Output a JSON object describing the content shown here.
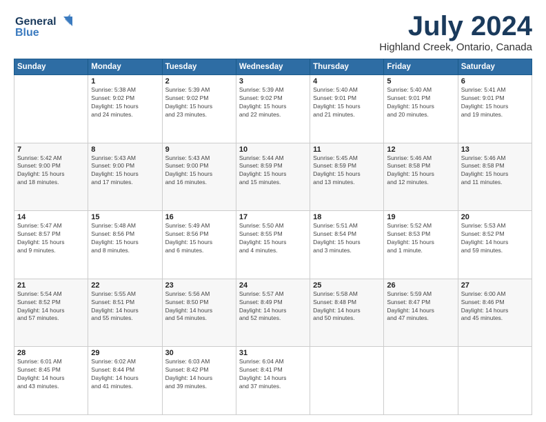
{
  "logo": {
    "line1": "General",
    "line2": "Blue",
    "bird": "▲"
  },
  "title": "July 2024",
  "location": "Highland Creek, Ontario, Canada",
  "days_of_week": [
    "Sunday",
    "Monday",
    "Tuesday",
    "Wednesday",
    "Thursday",
    "Friday",
    "Saturday"
  ],
  "weeks": [
    [
      {
        "day": "",
        "info": ""
      },
      {
        "day": "1",
        "info": "Sunrise: 5:38 AM\nSunset: 9:02 PM\nDaylight: 15 hours\nand 24 minutes."
      },
      {
        "day": "2",
        "info": "Sunrise: 5:39 AM\nSunset: 9:02 PM\nDaylight: 15 hours\nand 23 minutes."
      },
      {
        "day": "3",
        "info": "Sunrise: 5:39 AM\nSunset: 9:02 PM\nDaylight: 15 hours\nand 22 minutes."
      },
      {
        "day": "4",
        "info": "Sunrise: 5:40 AM\nSunset: 9:01 PM\nDaylight: 15 hours\nand 21 minutes."
      },
      {
        "day": "5",
        "info": "Sunrise: 5:40 AM\nSunset: 9:01 PM\nDaylight: 15 hours\nand 20 minutes."
      },
      {
        "day": "6",
        "info": "Sunrise: 5:41 AM\nSunset: 9:01 PM\nDaylight: 15 hours\nand 19 minutes."
      }
    ],
    [
      {
        "day": "7",
        "info": "Sunrise: 5:42 AM\nSunset: 9:00 PM\nDaylight: 15 hours\nand 18 minutes."
      },
      {
        "day": "8",
        "info": "Sunrise: 5:43 AM\nSunset: 9:00 PM\nDaylight: 15 hours\nand 17 minutes."
      },
      {
        "day": "9",
        "info": "Sunrise: 5:43 AM\nSunset: 9:00 PM\nDaylight: 15 hours\nand 16 minutes."
      },
      {
        "day": "10",
        "info": "Sunrise: 5:44 AM\nSunset: 8:59 PM\nDaylight: 15 hours\nand 15 minutes."
      },
      {
        "day": "11",
        "info": "Sunrise: 5:45 AM\nSunset: 8:59 PM\nDaylight: 15 hours\nand 13 minutes."
      },
      {
        "day": "12",
        "info": "Sunrise: 5:46 AM\nSunset: 8:58 PM\nDaylight: 15 hours\nand 12 minutes."
      },
      {
        "day": "13",
        "info": "Sunrise: 5:46 AM\nSunset: 8:58 PM\nDaylight: 15 hours\nand 11 minutes."
      }
    ],
    [
      {
        "day": "14",
        "info": "Sunrise: 5:47 AM\nSunset: 8:57 PM\nDaylight: 15 hours\nand 9 minutes."
      },
      {
        "day": "15",
        "info": "Sunrise: 5:48 AM\nSunset: 8:56 PM\nDaylight: 15 hours\nand 8 minutes."
      },
      {
        "day": "16",
        "info": "Sunrise: 5:49 AM\nSunset: 8:56 PM\nDaylight: 15 hours\nand 6 minutes."
      },
      {
        "day": "17",
        "info": "Sunrise: 5:50 AM\nSunset: 8:55 PM\nDaylight: 15 hours\nand 4 minutes."
      },
      {
        "day": "18",
        "info": "Sunrise: 5:51 AM\nSunset: 8:54 PM\nDaylight: 15 hours\nand 3 minutes."
      },
      {
        "day": "19",
        "info": "Sunrise: 5:52 AM\nSunset: 8:53 PM\nDaylight: 15 hours\nand 1 minute."
      },
      {
        "day": "20",
        "info": "Sunrise: 5:53 AM\nSunset: 8:52 PM\nDaylight: 14 hours\nand 59 minutes."
      }
    ],
    [
      {
        "day": "21",
        "info": "Sunrise: 5:54 AM\nSunset: 8:52 PM\nDaylight: 14 hours\nand 57 minutes."
      },
      {
        "day": "22",
        "info": "Sunrise: 5:55 AM\nSunset: 8:51 PM\nDaylight: 14 hours\nand 55 minutes."
      },
      {
        "day": "23",
        "info": "Sunrise: 5:56 AM\nSunset: 8:50 PM\nDaylight: 14 hours\nand 54 minutes."
      },
      {
        "day": "24",
        "info": "Sunrise: 5:57 AM\nSunset: 8:49 PM\nDaylight: 14 hours\nand 52 minutes."
      },
      {
        "day": "25",
        "info": "Sunrise: 5:58 AM\nSunset: 8:48 PM\nDaylight: 14 hours\nand 50 minutes."
      },
      {
        "day": "26",
        "info": "Sunrise: 5:59 AM\nSunset: 8:47 PM\nDaylight: 14 hours\nand 47 minutes."
      },
      {
        "day": "27",
        "info": "Sunrise: 6:00 AM\nSunset: 8:46 PM\nDaylight: 14 hours\nand 45 minutes."
      }
    ],
    [
      {
        "day": "28",
        "info": "Sunrise: 6:01 AM\nSunset: 8:45 PM\nDaylight: 14 hours\nand 43 minutes."
      },
      {
        "day": "29",
        "info": "Sunrise: 6:02 AM\nSunset: 8:44 PM\nDaylight: 14 hours\nand 41 minutes."
      },
      {
        "day": "30",
        "info": "Sunrise: 6:03 AM\nSunset: 8:42 PM\nDaylight: 14 hours\nand 39 minutes."
      },
      {
        "day": "31",
        "info": "Sunrise: 6:04 AM\nSunset: 8:41 PM\nDaylight: 14 hours\nand 37 minutes."
      },
      {
        "day": "",
        "info": ""
      },
      {
        "day": "",
        "info": ""
      },
      {
        "day": "",
        "info": ""
      }
    ]
  ]
}
